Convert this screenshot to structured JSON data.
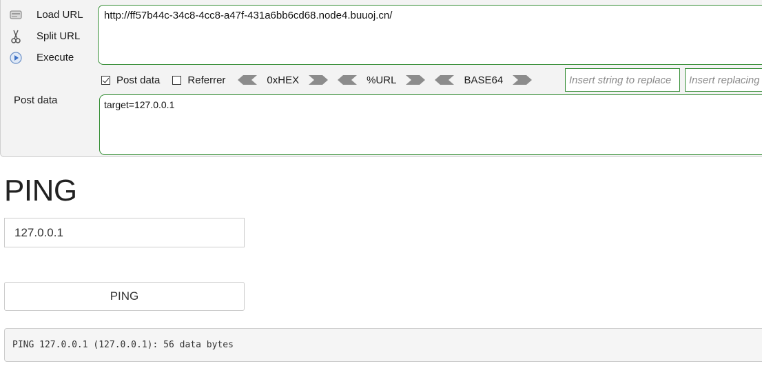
{
  "hackbar": {
    "actions": [
      {
        "label": "Load URL",
        "icon": "load-url-icon"
      },
      {
        "label": "Split URL",
        "icon": "scissors-icon"
      },
      {
        "label": "Execute",
        "icon": "play-icon"
      }
    ],
    "url": "http://ff57b44c-34c8-4cc8-a47f-431a6bb6cd68.node4.buuoj.cn/",
    "options": {
      "post_data_label": "Post data",
      "post_data_checked": true,
      "referrer_label": "Referrer",
      "referrer_checked": false
    },
    "encoders": [
      {
        "label": "0xHEX"
      },
      {
        "label": "%URL"
      },
      {
        "label": "BASE64"
      }
    ],
    "replace_placeholder": "Insert string to replace",
    "replacing_placeholder": "Insert replacing string",
    "post_data_field_label": "Post data",
    "post_data_value": "target=127.0.0.1",
    "accent_color": "#2f8a2f"
  },
  "page": {
    "title": "PING",
    "ip_value": "127.0.0.1",
    "button_label": "PING",
    "output": "PING 127.0.0.1 (127.0.0.1): 56 data bytes"
  }
}
